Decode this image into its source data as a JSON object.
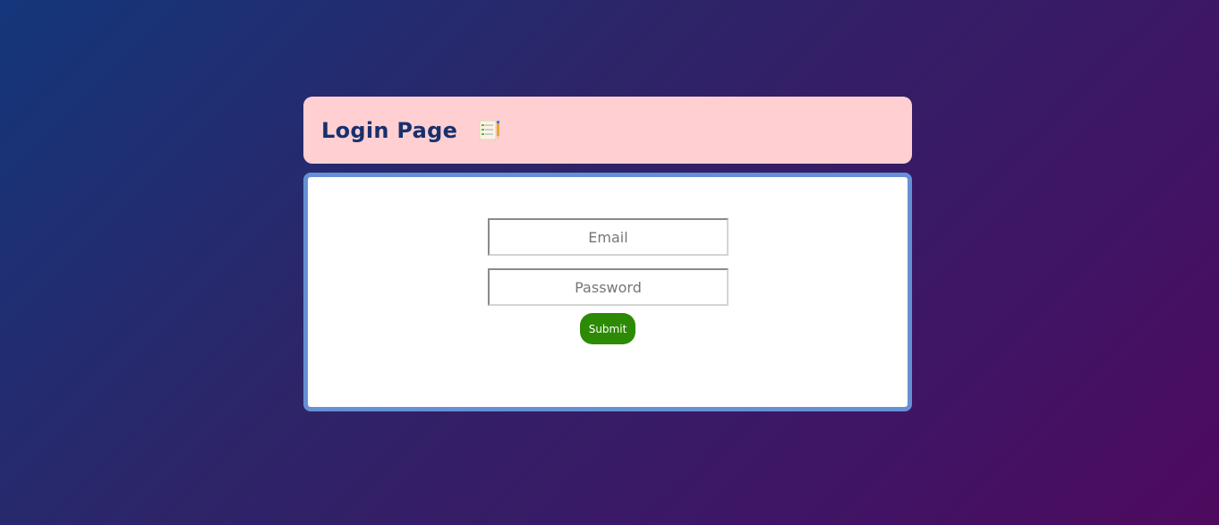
{
  "header": {
    "title": "Login Page",
    "icon": "notepad-checklist-icon"
  },
  "form": {
    "email_placeholder": "Email",
    "email_value": "",
    "password_placeholder": "Password",
    "password_value": "",
    "submit_label": "Submit"
  },
  "colors": {
    "background_start": "#14367a",
    "background_end": "#4e0a5e",
    "header_bg": "#ffcfd1",
    "title_color": "#17306e",
    "form_border": "#6690d4",
    "submit_bg": "#2c8a04"
  }
}
